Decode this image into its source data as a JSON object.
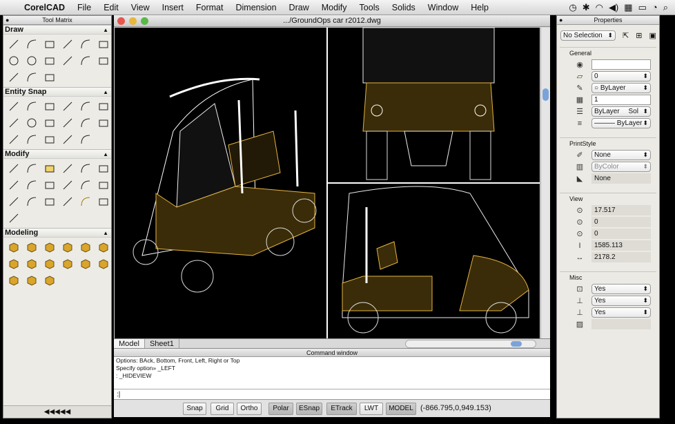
{
  "menubar": {
    "apple": "",
    "items": [
      "CorelCAD",
      "File",
      "Edit",
      "View",
      "Insert",
      "Format",
      "Dimension",
      "Draw",
      "Modify",
      "Tools",
      "Solids",
      "Window",
      "Help"
    ]
  },
  "toolmatrix": {
    "title": "Tool Matrix",
    "sections": [
      {
        "name": "Draw",
        "icons": [
          "line-icon",
          "polyline-icon",
          "polygon-icon",
          "rectangle-icon",
          "spline-icon",
          "arc-icon",
          "circle-icon",
          "ellipse-icon",
          "point-icon",
          "freehand-icon",
          "hatch-icon",
          "insert-block-icon",
          "cloud-icon",
          "text-icon",
          "simple-note-icon"
        ]
      },
      {
        "name": "Entity Snap",
        "icons": [
          "snap-endpoint-icon",
          "snap-midpoint-icon",
          "snap-intersection-icon",
          "snap-apparent-icon",
          "snap-extension-icon",
          "snap-perpendicular-icon",
          "snap-parallel-icon",
          "snap-center-icon",
          "snap-quadrant-icon",
          "snap-tangent-icon",
          "snap-insertion-icon",
          "snap-nearest-icon",
          "snap-node-icon",
          "snap-none-icon",
          "snap-from-icon",
          "snap-settings-icon",
          "snap-track-icon"
        ]
      },
      {
        "name": "Modify",
        "icons": [
          "erase-icon",
          "mirror-icon",
          "copy-icon",
          "offset-icon",
          "pattern-icon",
          "move-icon",
          "scale-icon",
          "stretch-icon",
          "fillet-icon",
          "chamfer-icon",
          "edit-arc-icon",
          "trim-icon",
          "extend-icon",
          "break-icon",
          "split-icon",
          "edit-hatch-icon",
          "paste-icon",
          "explode-icon",
          "weld-icon"
        ]
      },
      {
        "name": "Modeling",
        "icons": [
          "box-icon",
          "wedge-icon",
          "cone-icon",
          "sphere-icon",
          "cylinder-icon",
          "torus-icon",
          "pyramid-icon",
          "extrude-icon",
          "sweep-icon",
          "revolve-icon",
          "loft-icon",
          "union-icon",
          "subtract-icon",
          "intersect-icon",
          "slice-icon"
        ]
      }
    ],
    "footer": "◀◀◀◀◀"
  },
  "drawing": {
    "title": ".../GroundOps car r2012.dwg",
    "tabs": [
      "Model",
      "Sheet1"
    ]
  },
  "command": {
    "title": "Command window",
    "lines": [
      "Options: BAck, Bottom, Front, Left, Right or Top",
      "Specify option» _LEFT",
      ": _HIDEVIEW"
    ],
    "prompt": ":|"
  },
  "statusbar": {
    "buttons": [
      "Snap",
      "Grid",
      "Ortho",
      "Polar",
      "ESnap",
      "ETrack",
      "LWT",
      "MODEL"
    ],
    "coords": "(-866.795,0,949.153)"
  },
  "properties": {
    "title": "Properties",
    "selection": "No Selection",
    "general_h": "General",
    "general": [
      "",
      "0",
      "ByLayer",
      "1",
      "ByLayer",
      "ByLayer"
    ],
    "general_extra": "Sol",
    "printstyle_h": "PrintStyle",
    "printstyle": [
      "None",
      "ByColor",
      "None"
    ],
    "view_h": "View",
    "view": [
      "17.517",
      "0",
      "0",
      "1585.113",
      "2178.2"
    ],
    "misc_h": "Misc",
    "misc": [
      "Yes",
      "Yes",
      "Yes",
      ""
    ]
  }
}
